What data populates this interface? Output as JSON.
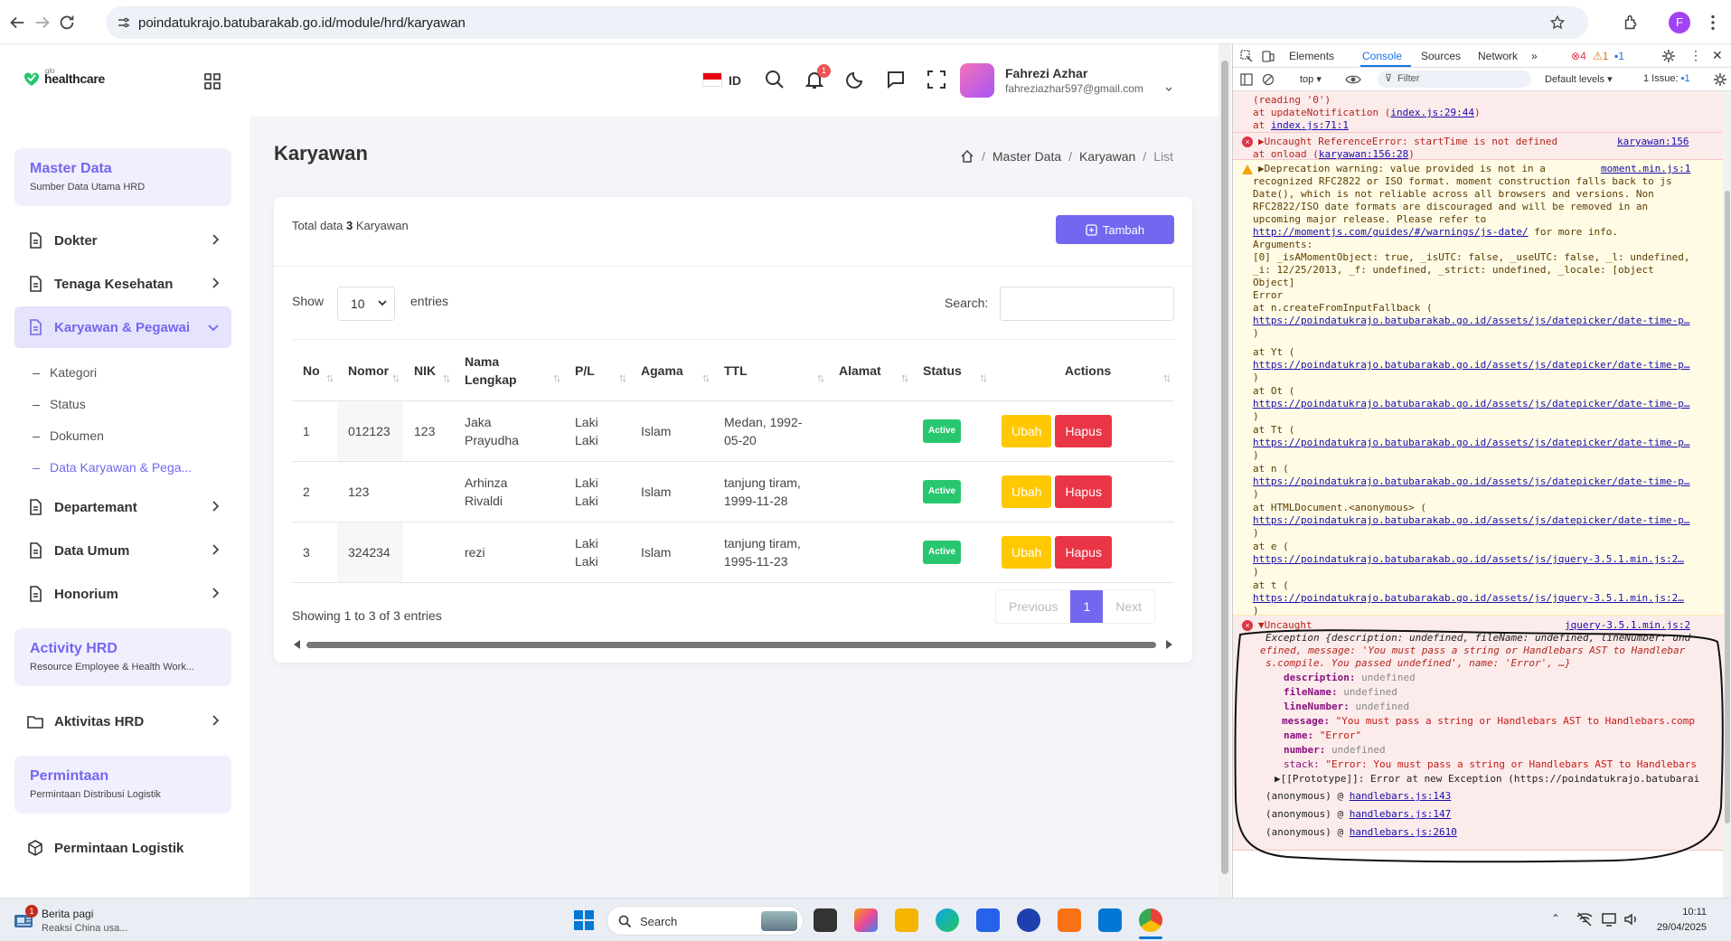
{
  "browser": {
    "url": "poindatukrajo.batubarakab.go.id/module/hrd/karyawan",
    "profile_initial": "F"
  },
  "sidebar": {
    "logo_sub": "glo",
    "logo_text": "healthcare",
    "sections": [
      {
        "title": "Master Data",
        "subtitle": "Sumber Data Utama HRD"
      },
      {
        "title": "Activity HRD",
        "subtitle": "Resource Employee & Health Work..."
      },
      {
        "title": "Permintaan",
        "subtitle": "Permintaan Distribusi Logistik"
      }
    ],
    "menu": [
      {
        "label": "Dokter"
      },
      {
        "label": "Tenaga Kesehatan"
      },
      {
        "label": "Karyawan & Pegawai"
      },
      {
        "label": "Departemant"
      },
      {
        "label": "Data Umum"
      },
      {
        "label": "Honorium"
      },
      {
        "label": "Aktivitas HRD"
      },
      {
        "label": "Permintaan Logistik"
      }
    ],
    "submenu": [
      "Kategori",
      "Status",
      "Dokumen",
      "Data Karyawan & Pega..."
    ]
  },
  "header": {
    "lang": "ID",
    "notif_count": "1",
    "user_name": "Fahrezi Azhar",
    "user_email": "fahreziazhar597@gmail.com"
  },
  "page": {
    "title": "Karyawan",
    "breadcrumb": [
      "Master Data",
      "Karyawan",
      "List"
    ],
    "total_prefix": "Total data",
    "total_count": "3",
    "total_suffix": "Karyawan",
    "add_label": "Tambah",
    "show_label": "Show",
    "entries_value": "10",
    "entries_label": "entries",
    "search_label": "Search:",
    "columns": [
      "No",
      "Nomor",
      "NIK",
      "Nama Lengkap",
      "P/L",
      "Agama",
      "TTL",
      "Alamat",
      "Status",
      "Actions"
    ],
    "rows": [
      {
        "no": "1",
        "nomor": "012123",
        "nik": "123",
        "nama": "Jaka Prayudha",
        "pl": "Laki Laki",
        "agama": "Islam",
        "ttl": "Medan, 1992-05-20",
        "alamat": "",
        "status": "Active"
      },
      {
        "no": "2",
        "nomor": "123",
        "nik": "",
        "nama": "Arhinza Rivaldi",
        "pl": "Laki Laki",
        "agama": "Islam",
        "ttl": "tanjung tiram, 1999-11-28",
        "alamat": "",
        "status": "Active"
      },
      {
        "no": "3",
        "nomor": "324234",
        "nik": "",
        "nama": "rezi",
        "pl": "Laki Laki",
        "agama": "Islam",
        "ttl": "tanjung tiram, 1995-11-23",
        "alamat": "",
        "status": "Active"
      }
    ],
    "edit_label": "Ubah",
    "delete_label": "Hapus",
    "showing_text": "Showing 1 to 3 of 3 entries",
    "pager": {
      "prev": "Previous",
      "current": "1",
      "next": "Next"
    }
  },
  "devtools": {
    "tabs": [
      "Elements",
      "Console",
      "Sources",
      "Network"
    ],
    "error_count": "4",
    "warn_count": "1",
    "info_count": "1",
    "context": "top",
    "filter_placeholder": "Filter",
    "levels": "Default levels",
    "issues_label": "1 Issue:",
    "issues_count": "1",
    "console_lines": {
      "e1": [
        "(reading '0')",
        "    at updateNotification (",
        "index.js:29:44",
        ")",
        "    at ",
        "index.js:71:1"
      ],
      "e2": [
        "▶Uncaught ReferenceError: startTime is not defined",
        "karyawan:156",
        "    at onload (",
        "karyawan:156:28",
        ")"
      ],
      "w1": [
        "▶Deprecation warning: value provided is not in a",
        "moment.min.js:1",
        "recognized RFC2822 or ISO format. moment construction falls back to js",
        "Date(), which is not reliable across all browsers and versions. Non",
        "RFC2822/ISO date formats are discouraged and will be removed in an",
        "upcoming major release. Please refer to",
        "http://momentjs.com/guides/#/warnings/js-date/",
        " for more info.",
        "Arguments:",
        "[0] _isAMomentObject: true, _isUTC: false, _useUTC: false, _l: undefined,",
        "_i: 12/25/2013, _f: undefined, _strict: undefined, _locale: [object",
        "Object]",
        "Error",
        "    at n.createFromInputFallback (",
        "https://poindatukrajo.batubarakab.go.id/assets/js/datepicker/date-time-p…",
        ")",
        "    at Yt (",
        "    at Ot (",
        "    at Tt (",
        "    at n (",
        "    at HTMLDocument.<anonymous> (",
        "    at e (",
        "https://poindatukrajo.batubarakab.go.id/assets/js/jquery-3.5.1.min.js:2…",
        "    at t ("
      ],
      "e3": [
        "▼Uncaught",
        "jquery-3.5.1.min.js:2",
        "Exception {description: undefined, fileName: undefined, lineNumber: und",
        "efined, message: 'You must pass a string or Handlebars AST to Handlebar",
        "s.compile. You passed undefined', name: 'Error', …}",
        "description:",
        "undefined",
        "fileName:",
        "lineNumber:",
        "message:",
        "\"You must pass a string or Handlebars AST to Handlebars.comp",
        "name:",
        "\"Error\"",
        "number:",
        "stack:",
        "\"Error: You must pass a string or Handlebars AST to Handlebars",
        "▶[[Prototype]]: Error at new Exception (https://poindatukrajo.batubarai",
        "(anonymous) @ ",
        "handlebars.js:143",
        "handlebars.js:147",
        "handlebars.js:2610"
      ]
    },
    "prompt": "›"
  },
  "taskbar": {
    "news_badge": "1",
    "news_title": "Berita pagi",
    "news_sub": "Reaksi China usa...",
    "search": "Search",
    "time": "10:11",
    "date": "29/04/2025"
  },
  "colors": {
    "primary": "#7367f0",
    "success": "#28c76f",
    "warning": "#ffc800",
    "danger": "#ea3546"
  }
}
